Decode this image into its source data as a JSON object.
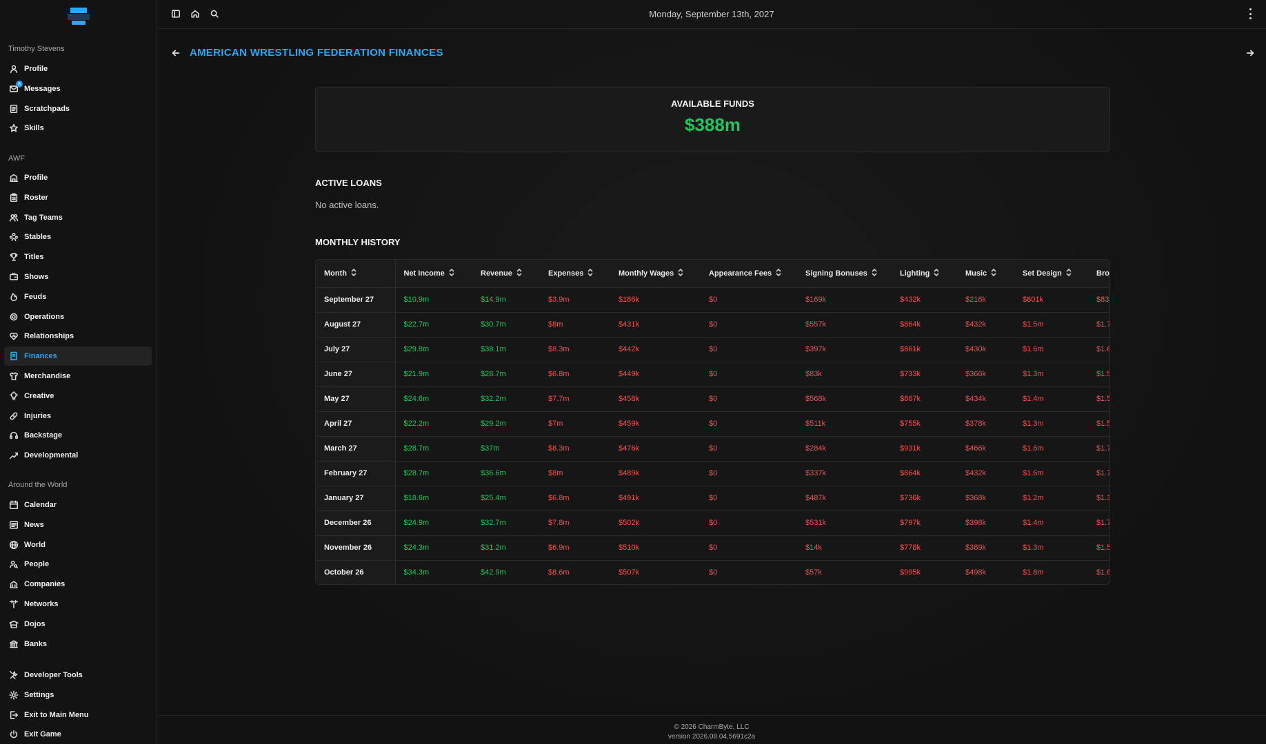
{
  "sidebar": {
    "user_group": "Timothy Stevens",
    "user_items": [
      {
        "label": "Profile",
        "icon": "user-icon"
      },
      {
        "label": "Messages",
        "icon": "mail-icon",
        "badge": "8"
      },
      {
        "label": "Scratchpads",
        "icon": "notepad-icon"
      },
      {
        "label": "Skills",
        "icon": "star-icon"
      }
    ],
    "org_group": "AWF",
    "org_items": [
      {
        "label": "Profile",
        "icon": "building-icon"
      },
      {
        "label": "Roster",
        "icon": "clipboard-icon"
      },
      {
        "label": "Tag Teams",
        "icon": "users-icon"
      },
      {
        "label": "Stables",
        "icon": "group-icon"
      },
      {
        "label": "Titles",
        "icon": "trophy-icon"
      },
      {
        "label": "Shows",
        "icon": "tv-icon"
      },
      {
        "label": "Feuds",
        "icon": "flame-icon"
      },
      {
        "label": "Operations",
        "icon": "cog-icon"
      },
      {
        "label": "Relationships",
        "icon": "heart-icon"
      },
      {
        "label": "Finances",
        "icon": "receipt-icon",
        "active": true
      },
      {
        "label": "Merchandise",
        "icon": "shirt-icon"
      },
      {
        "label": "Creative",
        "icon": "lightbulb-icon"
      },
      {
        "label": "Injuries",
        "icon": "bandage-icon"
      },
      {
        "label": "Backstage",
        "icon": "headset-icon"
      },
      {
        "label": "Developmental",
        "icon": "trend-icon"
      }
    ],
    "world_group": "Around the World",
    "world_items": [
      {
        "label": "Calendar",
        "icon": "calendar-icon"
      },
      {
        "label": "News",
        "icon": "newspaper-icon"
      },
      {
        "label": "World",
        "icon": "globe-icon"
      },
      {
        "label": "People",
        "icon": "person-search-icon"
      },
      {
        "label": "Companies",
        "icon": "companies-icon"
      },
      {
        "label": "Networks",
        "icon": "antenna-icon"
      },
      {
        "label": "Dojos",
        "icon": "dojo-icon"
      },
      {
        "label": "Banks",
        "icon": "bank-icon"
      }
    ],
    "bottom_items": [
      {
        "label": "Developer Tools",
        "icon": "tools-icon"
      },
      {
        "label": "Settings",
        "icon": "settings-icon"
      },
      {
        "label": "Exit to Main Menu",
        "icon": "exit-icon"
      },
      {
        "label": "Exit Game",
        "icon": "power-icon"
      }
    ]
  },
  "topbar": {
    "date": "Monday, September 13th, 2027"
  },
  "page": {
    "title": "AMERICAN WRESTLING FEDERATION FINANCES",
    "funds_label": "AVAILABLE FUNDS",
    "funds_value": "$388m",
    "loans_heading": "ACTIVE LOANS",
    "loans_empty": "No active loans.",
    "history_heading": "MONTHLY HISTORY"
  },
  "table": {
    "columns": [
      "Month",
      "Net Income",
      "Revenue",
      "Expenses",
      "Monthly Wages",
      "Appearance Fees",
      "Signing Bonuses",
      "Lighting",
      "Music",
      "Set Design",
      "Bro"
    ],
    "rows": [
      [
        "September 27",
        "$10.9m",
        "$14.9m",
        "$3.9m",
        "$186k",
        "$0",
        "$169k",
        "$432k",
        "$216k",
        "$801k",
        "$83"
      ],
      [
        "August 27",
        "$22.7m",
        "$30.7m",
        "$8m",
        "$431k",
        "$0",
        "$557k",
        "$864k",
        "$432k",
        "$1.5m",
        "$1.7"
      ],
      [
        "July 27",
        "$29.8m",
        "$38.1m",
        "$8.3m",
        "$442k",
        "$0",
        "$397k",
        "$861k",
        "$430k",
        "$1.6m",
        "$1.6"
      ],
      [
        "June 27",
        "$21.9m",
        "$28.7m",
        "$6.8m",
        "$449k",
        "$0",
        "$83k",
        "$733k",
        "$366k",
        "$1.3m",
        "$1.5"
      ],
      [
        "May 27",
        "$24.6m",
        "$32.2m",
        "$7.7m",
        "$458k",
        "$0",
        "$568k",
        "$867k",
        "$434k",
        "$1.4m",
        "$1.5"
      ],
      [
        "April 27",
        "$22.2m",
        "$29.2m",
        "$7m",
        "$459k",
        "$0",
        "$511k",
        "$755k",
        "$378k",
        "$1.3m",
        "$1.5"
      ],
      [
        "March 27",
        "$28.7m",
        "$37m",
        "$8.3m",
        "$476k",
        "$0",
        "$284k",
        "$931k",
        "$466k",
        "$1.6m",
        "$1.7"
      ],
      [
        "February 27",
        "$28.7m",
        "$36.6m",
        "$8m",
        "$489k",
        "$0",
        "$337k",
        "$864k",
        "$432k",
        "$1.6m",
        "$1.7"
      ],
      [
        "January 27",
        "$18.6m",
        "$25.4m",
        "$6.8m",
        "$491k",
        "$0",
        "$487k",
        "$736k",
        "$368k",
        "$1.2m",
        "$1.3"
      ],
      [
        "December 26",
        "$24.9m",
        "$32.7m",
        "$7.8m",
        "$502k",
        "$0",
        "$531k",
        "$797k",
        "$398k",
        "$1.4m",
        "$1.7"
      ],
      [
        "November 26",
        "$24.3m",
        "$31.2m",
        "$6.9m",
        "$510k",
        "$0",
        "$14k",
        "$778k",
        "$389k",
        "$1.3m",
        "$1.5"
      ],
      [
        "October 26",
        "$34.3m",
        "$42.9m",
        "$8.6m",
        "$507k",
        "$0",
        "$57k",
        "$995k",
        "$498k",
        "$1.8m",
        "$1.6"
      ]
    ]
  },
  "footer": {
    "copyright": "© 2026 CharmByte, LLC",
    "version": "version 2026.08.04.5691c2a"
  },
  "colors": {
    "accent": "#2ea7f0",
    "positive": "#22c55e",
    "negative": "#f05252"
  }
}
